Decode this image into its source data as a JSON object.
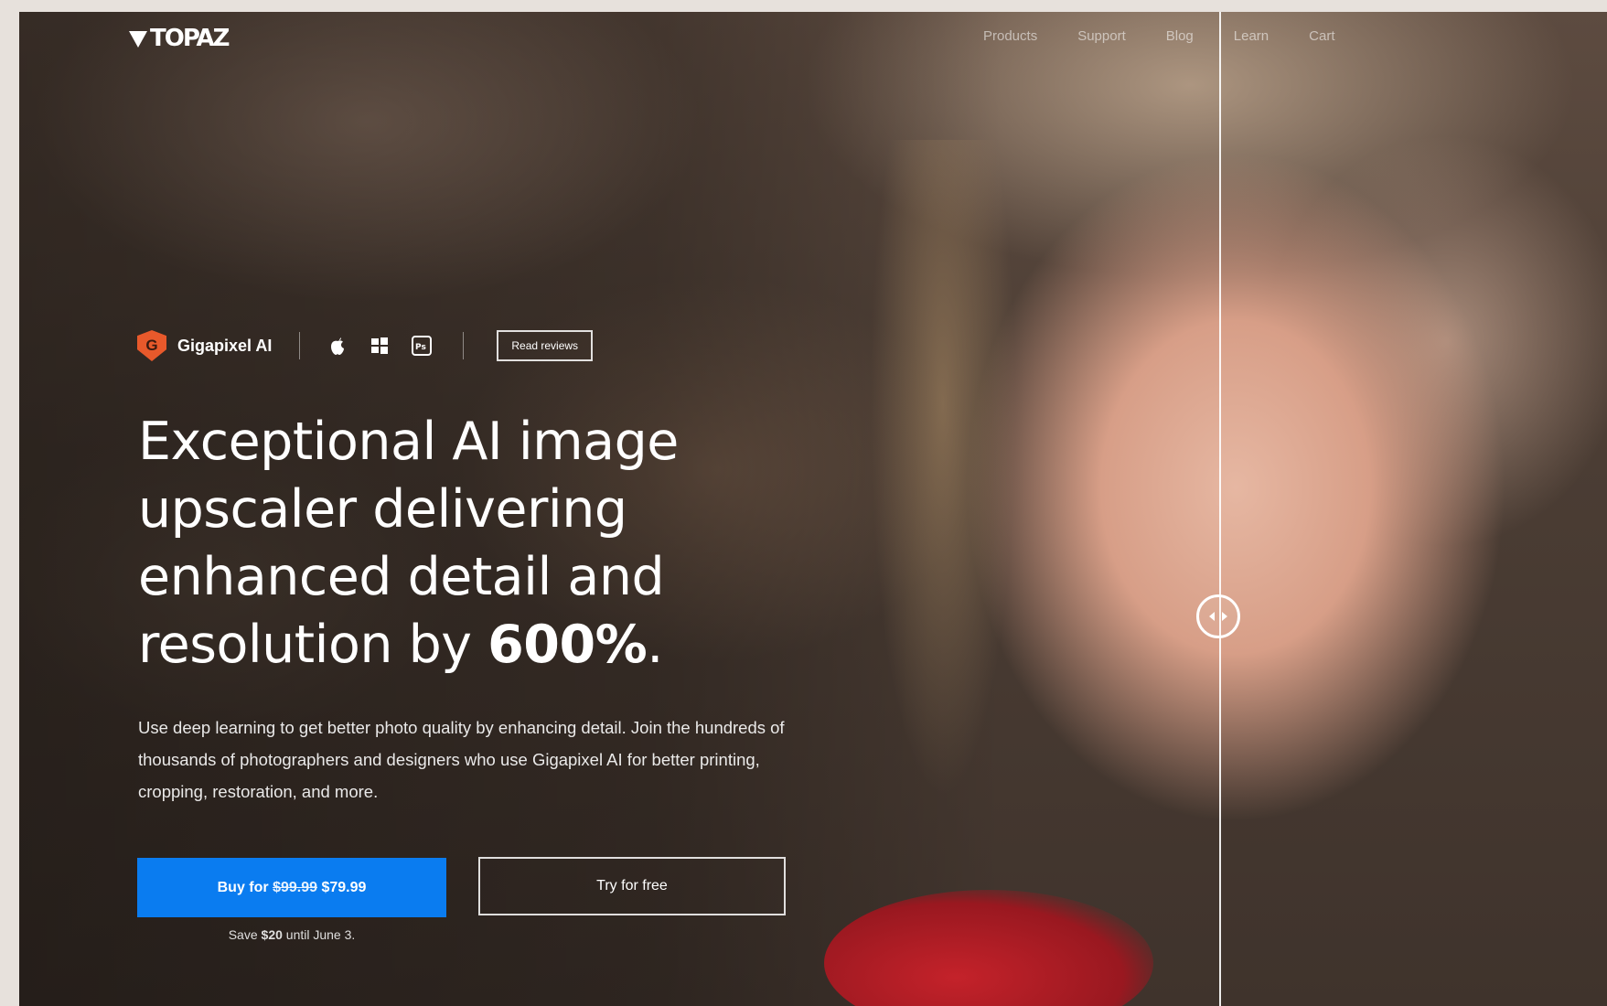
{
  "brand": {
    "logo_text": "TOPAZ"
  },
  "nav": {
    "items": [
      "Products",
      "Support",
      "Blog",
      "Learn",
      "Cart"
    ]
  },
  "product": {
    "badge_letter": "G",
    "name": "Gigapixel AI",
    "platforms": [
      "apple-icon",
      "windows-icon",
      "photoshop-icon"
    ],
    "reviews_label": "Read reviews"
  },
  "hero": {
    "headline_line1": "Exceptional AI image",
    "headline_line2": "upscaler delivering",
    "headline_line3": "enhanced detail and",
    "headline_line4_prefix": "resolution by ",
    "headline_highlight": "600%",
    "headline_suffix": ".",
    "description": "Use deep learning to get better photo quality by enhancing detail. Join the hundreds of thousands of photographers and designers who use Gigapixel AI for better printing, cropping, restoration, and more."
  },
  "cta": {
    "buy_prefix": "Buy for ",
    "old_price": "$99.99",
    "new_price": "$79.99",
    "try_label": "Try for free",
    "save_prefix": "Save ",
    "save_amount": "$20",
    "save_suffix": " until June 3."
  },
  "colors": {
    "accent": "#0a7cf0",
    "badge": "#e8592b"
  }
}
